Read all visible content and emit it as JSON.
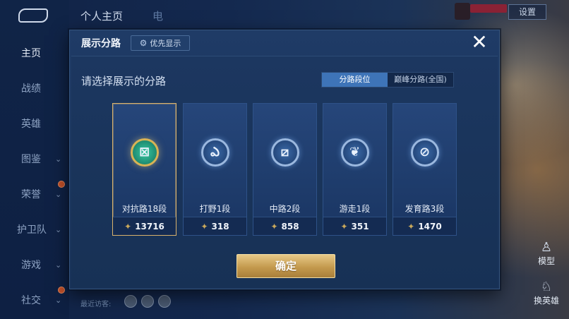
{
  "topbar": {
    "tab_profile": "个人主页",
    "tab_partial": "电",
    "settings_label": "设置"
  },
  "sidebar": {
    "items": [
      {
        "label": "主页"
      },
      {
        "label": "战绩"
      },
      {
        "label": "英雄"
      },
      {
        "label": "图鉴"
      },
      {
        "label": "荣誉"
      },
      {
        "label": "护卫队"
      },
      {
        "label": "游戏"
      },
      {
        "label": "社交"
      }
    ]
  },
  "dialog": {
    "title": "展示分路",
    "priority_label": "优先显示",
    "close_label": "✕",
    "subtitle": "请选择展示的分路",
    "segments": [
      "分路段位",
      "巅峰分路(全国)"
    ],
    "selected_segment": 0,
    "cards": [
      {
        "label": "对抗路18段",
        "value": "13716",
        "icon": "clash-lane-icon",
        "glyph": "⊠",
        "selected": true
      },
      {
        "label": "打野1段",
        "value": "318",
        "icon": "jungle-icon",
        "glyph": "ఎ",
        "selected": false
      },
      {
        "label": "中路2段",
        "value": "858",
        "icon": "mid-lane-icon",
        "glyph": "⧄",
        "selected": false
      },
      {
        "label": "游走1段",
        "value": "351",
        "icon": "roam-icon",
        "glyph": "❦",
        "selected": false
      },
      {
        "label": "发育路3段",
        "value": "1470",
        "icon": "farm-lane-icon",
        "glyph": "⊘",
        "selected": false
      }
    ],
    "confirm_label": "确定"
  },
  "bottom": {
    "recent_label": "最近访客:",
    "mode_label": "模型",
    "switch_hero_label": "换英雄"
  },
  "colors": {
    "accent_blue": "#3e74b8",
    "gold": "#d9b26c",
    "panel": "#1c3760"
  }
}
